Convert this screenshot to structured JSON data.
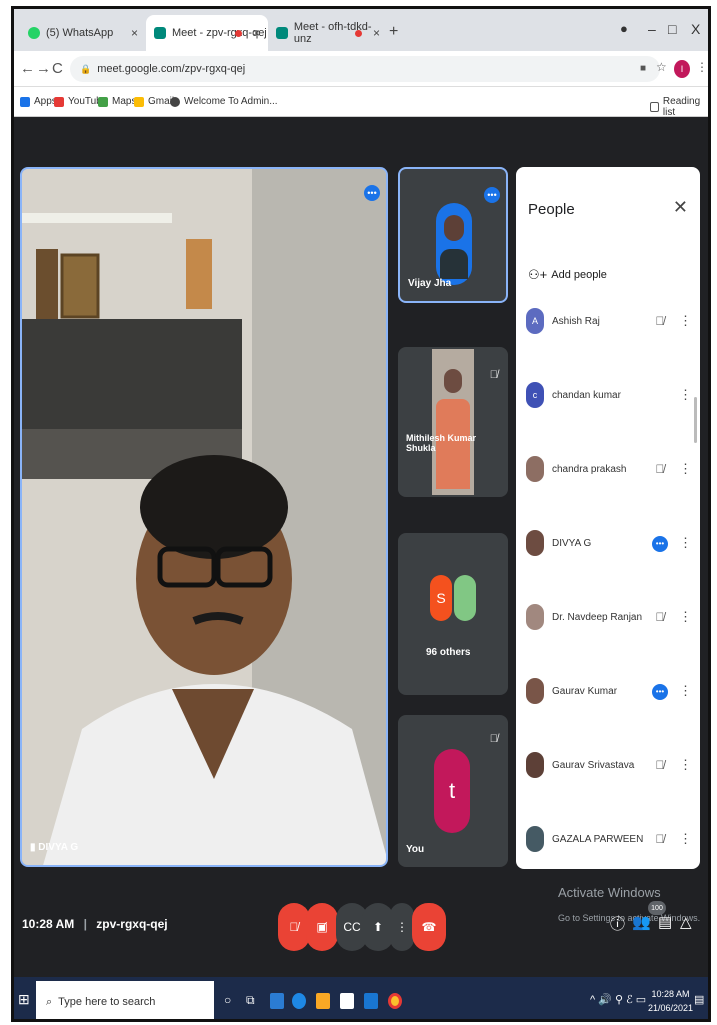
{
  "tabs": [
    {
      "title": "(5) WhatsApp",
      "color": "#25d366"
    },
    {
      "title": "Meet - zpv-rgxq-qej",
      "color": "#00897b"
    },
    {
      "title": "Meet - ofh-tdkd-unz",
      "color": "#00897b"
    }
  ],
  "window": {
    "minimize": "–",
    "maximize": "□",
    "close": "X"
  },
  "address": {
    "url": "meet.google.com/zpv-rgxq-qej",
    "profile_initial": "I"
  },
  "bookmarks": [
    {
      "label": "Apps",
      "color": "#ffb300"
    },
    {
      "label": "YouTube",
      "color": "#e53935"
    },
    {
      "label": "Maps",
      "color": "#43a047"
    },
    {
      "label": "Gmail",
      "color": "#fbbc05"
    },
    {
      "label": "Welcome To Admin...",
      "color": "#444"
    }
  ],
  "reading_list": "Reading list",
  "main_speaker": {
    "name": "DIVYA G"
  },
  "tiles": [
    {
      "name": "Vijay Jha",
      "muted": false
    },
    {
      "name": "Mithilesh Kumar Shukla",
      "muted": true
    },
    {
      "name": "96 others",
      "initial": "S"
    },
    {
      "name": "You",
      "initial": "t",
      "muted": true
    }
  ],
  "people_panel": {
    "title": "People",
    "add_label": "Add people",
    "participants": [
      {
        "name": "Ashish Raj",
        "initial": "A",
        "color": "#5c6bc0",
        "status": "muted"
      },
      {
        "name": "chandan kumar",
        "initial": "c",
        "color": "#3f51b5",
        "status": "none"
      },
      {
        "name": "chandra prakash",
        "initial": "",
        "color": "#8d6e63",
        "status": "muted"
      },
      {
        "name": "DIVYA G",
        "initial": "",
        "color": "#6d4c41",
        "status": "speaking"
      },
      {
        "name": "Dr. Navdeep Ranjan",
        "initial": "",
        "color": "#a1887f",
        "status": "muted"
      },
      {
        "name": "Gaurav Kumar",
        "initial": "",
        "color": "#795548",
        "status": "speaking"
      },
      {
        "name": "Gaurav Srivastava",
        "initial": "",
        "color": "#5d4037",
        "status": "muted"
      },
      {
        "name": "GAZALA PARWEEN",
        "initial": "",
        "color": "#455a64",
        "status": "muted"
      }
    ]
  },
  "meeting": {
    "time": "10:28 AM",
    "code": "zpv-rgxq-qej",
    "participant_count": "100"
  },
  "activate": {
    "title": "Activate Windows",
    "subtitle": "Go to Settings to activate Windows."
  },
  "taskbar": {
    "search_placeholder": "Type here to search",
    "time": "10:28 AM",
    "date": "21/06/2021"
  }
}
